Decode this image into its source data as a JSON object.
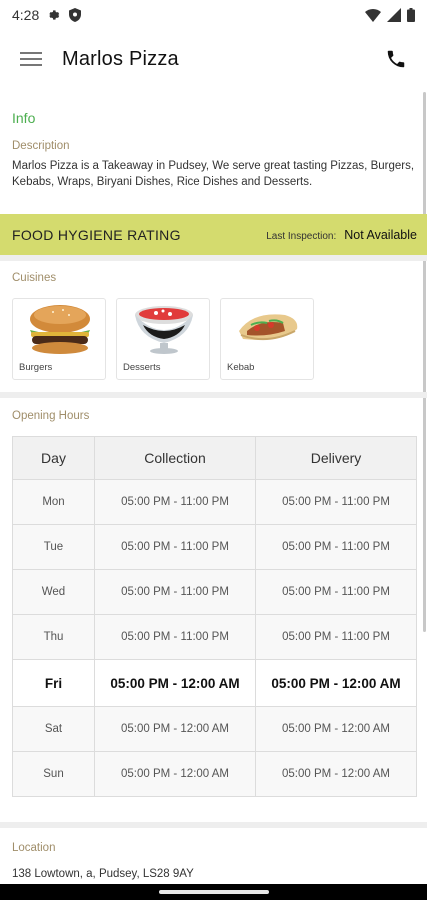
{
  "status_bar": {
    "time": "4:28",
    "icons": [
      "settings-icon",
      "shield-icon",
      "wifi-icon",
      "signal-icon",
      "battery-icon"
    ]
  },
  "app_bar": {
    "title": "Marlos Pizza",
    "left_icon": "menu-icon",
    "right_icon": "phone-icon"
  },
  "info": {
    "heading": "Info",
    "description_label": "Description",
    "description": "Marlos Pizza is a Takeaway in Pudsey, We serve great tasting Pizzas, Burgers, Kebabs, Wraps, Biryani Dishes, Rice Dishes and Desserts."
  },
  "hygiene": {
    "title": "FOOD HYGIENE RATING",
    "inspection_label": "Last Inspection:",
    "inspection_value": "Not Available",
    "bar_color": "#d4db6e"
  },
  "cuisines": {
    "label": "Cuisines",
    "items": [
      {
        "name": "Burgers",
        "image": "burger-image"
      },
      {
        "name": "Desserts",
        "image": "dessert-image"
      },
      {
        "name": "Kebab",
        "image": "kebab-image"
      }
    ]
  },
  "opening_hours": {
    "label": "Opening Hours",
    "headers": [
      "Day",
      "Collection",
      "Delivery"
    ],
    "rows": [
      {
        "day": "Mon",
        "collection": "05:00 PM - 11:00 PM",
        "delivery": "05:00 PM - 11:00 PM"
      },
      {
        "day": "Tue",
        "collection": "05:00 PM - 11:00 PM",
        "delivery": "05:00 PM - 11:00 PM"
      },
      {
        "day": "Wed",
        "collection": "05:00 PM - 11:00 PM",
        "delivery": "05:00 PM - 11:00 PM"
      },
      {
        "day": "Thu",
        "collection": "05:00 PM - 11:00 PM",
        "delivery": "05:00 PM - 11:00 PM"
      },
      {
        "day": "Fri",
        "collection": "05:00 PM - 12:00 AM",
        "delivery": "05:00 PM - 12:00 AM"
      },
      {
        "day": "Sat",
        "collection": "05:00 PM - 12:00 AM",
        "delivery": "05:00 PM - 12:00 AM"
      },
      {
        "day": "Sun",
        "collection": "05:00 PM - 12:00 AM",
        "delivery": "05:00 PM - 12:00 AM"
      }
    ],
    "highlighted_day": "Fri"
  },
  "location": {
    "label": "Location",
    "address": "138 Lowtown, a, Pudsey, LS28 9AY"
  },
  "colors": {
    "accent_green": "#4cae4f",
    "label_brown": "#a08e6a"
  }
}
